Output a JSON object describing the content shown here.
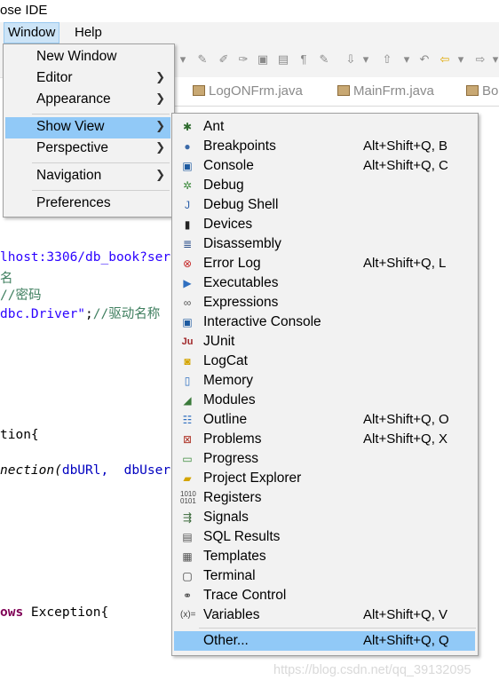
{
  "titlebar": {
    "text": "ose IDE"
  },
  "menubar": {
    "window": "Window",
    "help": "Help"
  },
  "tabs": [
    {
      "label": "LogONFrm.java"
    },
    {
      "label": "MainFrm.java"
    },
    {
      "label": "Bo"
    }
  ],
  "code": {
    "line1": "lhost:3306/db_book?ser",
    "line2": "名",
    "line3": "//密码",
    "line4_str": "dbc.Driver\"",
    "line4_rest": ";",
    "line4_cmt": "//驱动名称",
    "line5": "tion{",
    "line6_a": "nection(",
    "line6_b": "dbURl,  dbUser",
    "line7_kw": "ows",
    "line7_rest": " Exception{"
  },
  "window_menu": {
    "items": [
      {
        "label": "New Window",
        "submenu": false
      },
      {
        "label": "Editor",
        "submenu": true
      },
      {
        "label": "Appearance",
        "submenu": true
      },
      {
        "label": "Show View",
        "submenu": true,
        "selected": true
      },
      {
        "label": "Perspective",
        "submenu": true
      },
      {
        "label": "Navigation",
        "submenu": true
      },
      {
        "label": "Preferences",
        "submenu": false
      }
    ]
  },
  "show_view": {
    "items": [
      {
        "label": "Ant",
        "shortcut": "",
        "icon": "ant-icon"
      },
      {
        "label": "Breakpoints",
        "shortcut": "Alt+Shift+Q, B",
        "icon": "breakpoints-icon"
      },
      {
        "label": "Console",
        "shortcut": "Alt+Shift+Q, C",
        "icon": "console-icon"
      },
      {
        "label": "Debug",
        "shortcut": "",
        "icon": "debug-icon"
      },
      {
        "label": "Debug Shell",
        "shortcut": "",
        "icon": "debug-shell-icon"
      },
      {
        "label": "Devices",
        "shortcut": "",
        "icon": "devices-icon"
      },
      {
        "label": "Disassembly",
        "shortcut": "",
        "icon": "disassembly-icon"
      },
      {
        "label": "Error Log",
        "shortcut": "Alt+Shift+Q, L",
        "icon": "error-log-icon"
      },
      {
        "label": "Executables",
        "shortcut": "",
        "icon": "executables-icon"
      },
      {
        "label": "Expressions",
        "shortcut": "",
        "icon": "expressions-icon"
      },
      {
        "label": "Interactive Console",
        "shortcut": "",
        "icon": "interactive-console-icon"
      },
      {
        "label": "JUnit",
        "shortcut": "",
        "icon": "junit-icon"
      },
      {
        "label": "LogCat",
        "shortcut": "",
        "icon": "logcat-icon"
      },
      {
        "label": "Memory",
        "shortcut": "",
        "icon": "memory-icon"
      },
      {
        "label": "Modules",
        "shortcut": "",
        "icon": "modules-icon"
      },
      {
        "label": "Outline",
        "shortcut": "Alt+Shift+Q, O",
        "icon": "outline-icon"
      },
      {
        "label": "Problems",
        "shortcut": "Alt+Shift+Q, X",
        "icon": "problems-icon"
      },
      {
        "label": "Progress",
        "shortcut": "",
        "icon": "progress-icon"
      },
      {
        "label": "Project Explorer",
        "shortcut": "",
        "icon": "project-explorer-icon"
      },
      {
        "label": "Registers",
        "shortcut": "",
        "icon": "registers-icon"
      },
      {
        "label": "Signals",
        "shortcut": "",
        "icon": "signals-icon"
      },
      {
        "label": "SQL Results",
        "shortcut": "",
        "icon": "sql-results-icon"
      },
      {
        "label": "Templates",
        "shortcut": "",
        "icon": "templates-icon"
      },
      {
        "label": "Terminal",
        "shortcut": "",
        "icon": "terminal-icon"
      },
      {
        "label": "Trace Control",
        "shortcut": "",
        "icon": "trace-control-icon"
      },
      {
        "label": "Variables",
        "shortcut": "Alt+Shift+Q, V",
        "icon": "variables-icon"
      },
      {
        "label": "Other...",
        "shortcut": "Alt+Shift+Q, Q",
        "icon": "",
        "selected": true
      }
    ]
  },
  "watermark": "https://blog.csdn.net/qq_39132095"
}
